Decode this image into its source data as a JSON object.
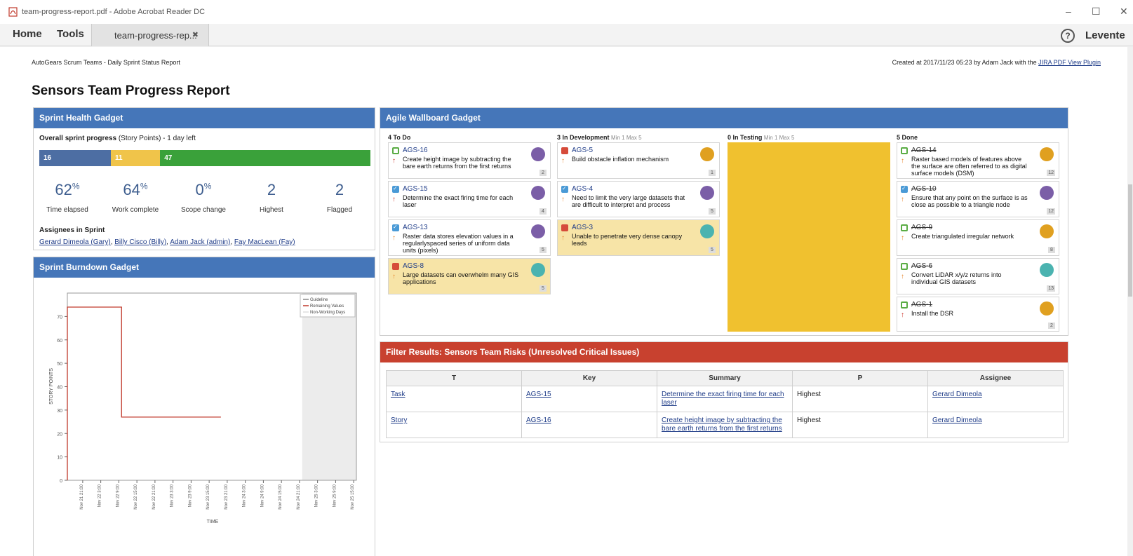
{
  "window": {
    "title": "team-progress-report.pdf - Adobe Acrobat Reader DC",
    "minimize": "–",
    "maximize": "☐",
    "close": "✕"
  },
  "toolbar": {
    "home": "Home",
    "tools": "Tools",
    "tab_label": "team-progress-rep...",
    "tab_close": "✖",
    "help": "?",
    "user": "Levente"
  },
  "report": {
    "header_left": "AutoGears Scrum Teams - Daily Sprint Status Report",
    "header_right_prefix": "Created at 2017/11/23 05:23 by Adam Jack with the",
    "header_right_link": "JIRA PDF View Plugin",
    "title": "Sensors Team Progress Report"
  },
  "sprint_health": {
    "title": "Sprint Health Gadget",
    "progress_label_bold": "Overall sprint progress",
    "progress_label_rest": "(Story Points) - 1 day left",
    "bar": [
      {
        "label": "16",
        "value": 16,
        "color": "#4d6ea3"
      },
      {
        "label": "11",
        "value": 11,
        "color": "#f0c44a"
      },
      {
        "label": "47",
        "value": 47,
        "color": "#3aa13a"
      }
    ],
    "stats": [
      {
        "value": "62",
        "unit": "%",
        "label": "Time elapsed"
      },
      {
        "value": "64",
        "unit": "%",
        "label": "Work complete"
      },
      {
        "value": "0",
        "unit": "%",
        "label": "Scope change"
      },
      {
        "value": "2",
        "unit": "",
        "label": "Highest"
      },
      {
        "value": "2",
        "unit": "",
        "label": "Flagged"
      }
    ],
    "assignees_title": "Assignees in Sprint",
    "assignees": [
      "Gerard Dimeola (Gary)",
      "Billy Cisco (Billy)",
      "Adam Jack (admin)",
      "Fay MacLean (Fay)"
    ]
  },
  "burndown": {
    "title": "Sprint Burndown Gadget"
  },
  "chart_data": {
    "type": "line",
    "xlabel": "TIME",
    "ylabel": "STORY POINTS",
    "ylim": [
      0,
      80
    ],
    "yticks": [
      0,
      10,
      20,
      30,
      40,
      50,
      60,
      70
    ],
    "x_ticks": [
      "Nov 21 21:00",
      "Nov 22 3:00",
      "Nov 22 9:00",
      "Nov 22 15:00",
      "Nov 22 21:00",
      "Nov 23 3:00",
      "Nov 23 9:00",
      "Nov 23 15:00",
      "Nov 23 21:00",
      "Nov 24 3:00",
      "Nov 24 9:00",
      "Nov 24 15:00",
      "Nov 24 21:00",
      "Nov 25 3:00",
      "Nov 25 9:00",
      "Nov 25 15:00"
    ],
    "legend": [
      "Guideline",
      "Remaining Values",
      "Non-Working Days"
    ],
    "legend_position": "top-right",
    "non_working_range_index": [
      13,
      16
    ],
    "series": [
      {
        "name": "Remaining Values",
        "color": "#c0392b",
        "x_index": [
          0,
          0,
          3,
          3,
          8.5
        ],
        "values": [
          0,
          74,
          74,
          27,
          27
        ]
      }
    ]
  },
  "wallboard": {
    "title": "Agile Wallboard Gadget",
    "columns": [
      {
        "title": "4 To Do",
        "minmax": ""
      },
      {
        "title": "3 In Development",
        "minmax": "Min 1 Max 5"
      },
      {
        "title": "0 In Testing",
        "minmax": "Min 1 Max 5"
      },
      {
        "title": "5 Done",
        "minmax": ""
      }
    ],
    "cards": [
      {
        "key": "AGS-16",
        "summary": "Create height image by subtracting the bare earth returns from the first returns",
        "type": "story",
        "prio": "highest",
        "points": "2",
        "avatar": "#7b5ea7",
        "hl": false,
        "done": false
      },
      {
        "key": "AGS-15",
        "summary": "Determine the exact firing time for each laser",
        "type": "task",
        "prio": "highest",
        "points": "4",
        "avatar": "#7b5ea7",
        "hl": false,
        "done": false
      },
      {
        "key": "AGS-13",
        "summary": "Raster data stores elevation values in a regularlyspaced series of uniform data units (pixels)",
        "type": "task",
        "prio": "high",
        "points": "5",
        "avatar": "#7b5ea7",
        "hl": false,
        "done": false
      },
      {
        "key": "AGS-8",
        "summary": "Large datasets can overwhelm many GIS applications",
        "type": "bug",
        "prio": "high",
        "points": "5",
        "avatar": "#4bb3b0",
        "hl": true,
        "done": false
      },
      {
        "key": "AGS-5",
        "summary": "Build obstacle inflation mechanism",
        "type": "bug",
        "prio": "high",
        "points": "1",
        "avatar": "#e0a020",
        "hl": false,
        "done": false
      },
      {
        "key": "AGS-4",
        "summary": "Need to limit the very large datasets that are difficult to interpret and process",
        "type": "task",
        "prio": "high",
        "points": "5",
        "avatar": "#7b5ea7",
        "hl": false,
        "done": false
      },
      {
        "key": "AGS-3",
        "summary": "Unable to penetrate very dense canopy leads",
        "type": "bug",
        "prio": "high",
        "points": "5",
        "avatar": "#4bb3b0",
        "hl": true,
        "done": false
      },
      {
        "key": "AGS-14",
        "summary": "Raster based models of features above the surface are often referred to as digital surface models (DSM)",
        "type": "story",
        "prio": "high",
        "points": "12",
        "avatar": "#e0a020",
        "hl": false,
        "done": true
      },
      {
        "key": "AGS-10",
        "summary": "Ensure that any point on the surface is as close as possible to a triangle node",
        "type": "task",
        "prio": "high",
        "points": "12",
        "avatar": "#7b5ea7",
        "hl": false,
        "done": true
      },
      {
        "key": "AGS-9",
        "summary": "Create triangulated irregular network",
        "type": "story",
        "prio": "high",
        "points": "8",
        "avatar": "#e0a020",
        "hl": false,
        "done": true
      },
      {
        "key": "AGS-6",
        "summary": "Convert LiDAR x/y/z returns into individual GIS datasets",
        "type": "story",
        "prio": "high",
        "points": "13",
        "avatar": "#4bb3b0",
        "hl": false,
        "done": true
      },
      {
        "key": "AGS-1",
        "summary": "Install the DSR",
        "type": "story",
        "prio": "highest",
        "points": "2",
        "avatar": "#e0a020",
        "hl": false,
        "done": true
      }
    ]
  },
  "filter": {
    "title": "Filter Results: Sensors Team Risks (Unresolved Critical Issues)",
    "headers": [
      "T",
      "Key",
      "Summary",
      "P",
      "Assignee"
    ],
    "rows": [
      {
        "t": "Task",
        "key": "AGS-15",
        "summary": "Determine the exact firing time for each laser",
        "p": "Highest",
        "assignee": "Gerard Dimeola"
      },
      {
        "t": "Story",
        "key": "AGS-16",
        "summary": "Create height image by subtracting the bare earth returns from the first returns",
        "p": "Highest",
        "assignee": "Gerard Dimeola"
      }
    ]
  }
}
